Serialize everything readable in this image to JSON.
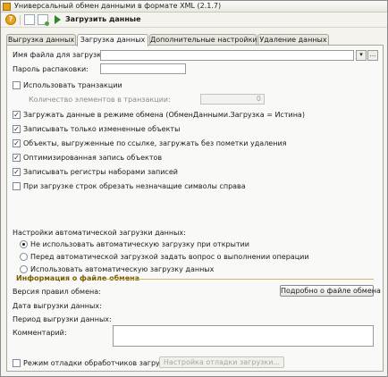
{
  "window": {
    "title": "Универсальный обмен данными в формате XML (2.1.7)"
  },
  "toolbar": {
    "help_glyph": "?",
    "run_label": "Загрузить данные"
  },
  "tabs": [
    {
      "label": "Выгрузка данных"
    },
    {
      "label": "Загрузка данных"
    },
    {
      "label": "Дополнительные настройки"
    },
    {
      "label": "Удаление данных"
    }
  ],
  "active_tab": "Загрузка данных",
  "form": {
    "file_label": "Имя файла для загрузки:",
    "file_value": "",
    "file_select_glyph": "▾",
    "file_browse_glyph": "...",
    "password_label": "Пароль распаковки:",
    "password_value": "",
    "use_transactions": {
      "label": "Использовать транзакции",
      "checked": false
    },
    "tx_count_label": "Количество элементов в транзакции:",
    "tx_count_value": "0",
    "exchange_mode": {
      "label": "Загружать данные в режиме обмена (ОбменДанными.Загрузка = Истина)",
      "checked": true
    },
    "only_changed": {
      "label": "Записывать только измененные объекты",
      "checked": true
    },
    "by_ref": {
      "label": "Объекты, выгруженные по ссылке, загружать без пометки удаления",
      "checked": true
    },
    "optimized": {
      "label": "Оптимизированная запись объектов",
      "checked": true
    },
    "registers": {
      "label": "Записывать регистры наборами записей",
      "checked": true
    },
    "trim": {
      "label": "При загрузке строк обрезать незначащие символы справа",
      "checked": false
    },
    "check_glyph": "✓"
  },
  "auto_load": {
    "label": "Настройки автоматической загрузки данных:",
    "options": [
      {
        "label": "Не использовать автоматическую загрузку при открытии",
        "selected": true
      },
      {
        "label": "Перед автоматической загрузкой задать вопрос о выполнении операции",
        "selected": false
      },
      {
        "label": "Использовать автоматическую загрузку данных",
        "selected": false
      }
    ]
  },
  "file_info": {
    "title": "Информация о файле обмена",
    "version_label": "Версия правил обмена:",
    "details_button": "Подробно о файле обмена",
    "date_label": "Дата выгрузки данных:",
    "period_label": "Период выгрузки данных:",
    "comment_label": "Комментарий:",
    "comment_value": ""
  },
  "debug": {
    "label": "Режим отладки обработчиков загрузки",
    "checked": false,
    "settings_button": "Настройка отладки загрузки..."
  }
}
